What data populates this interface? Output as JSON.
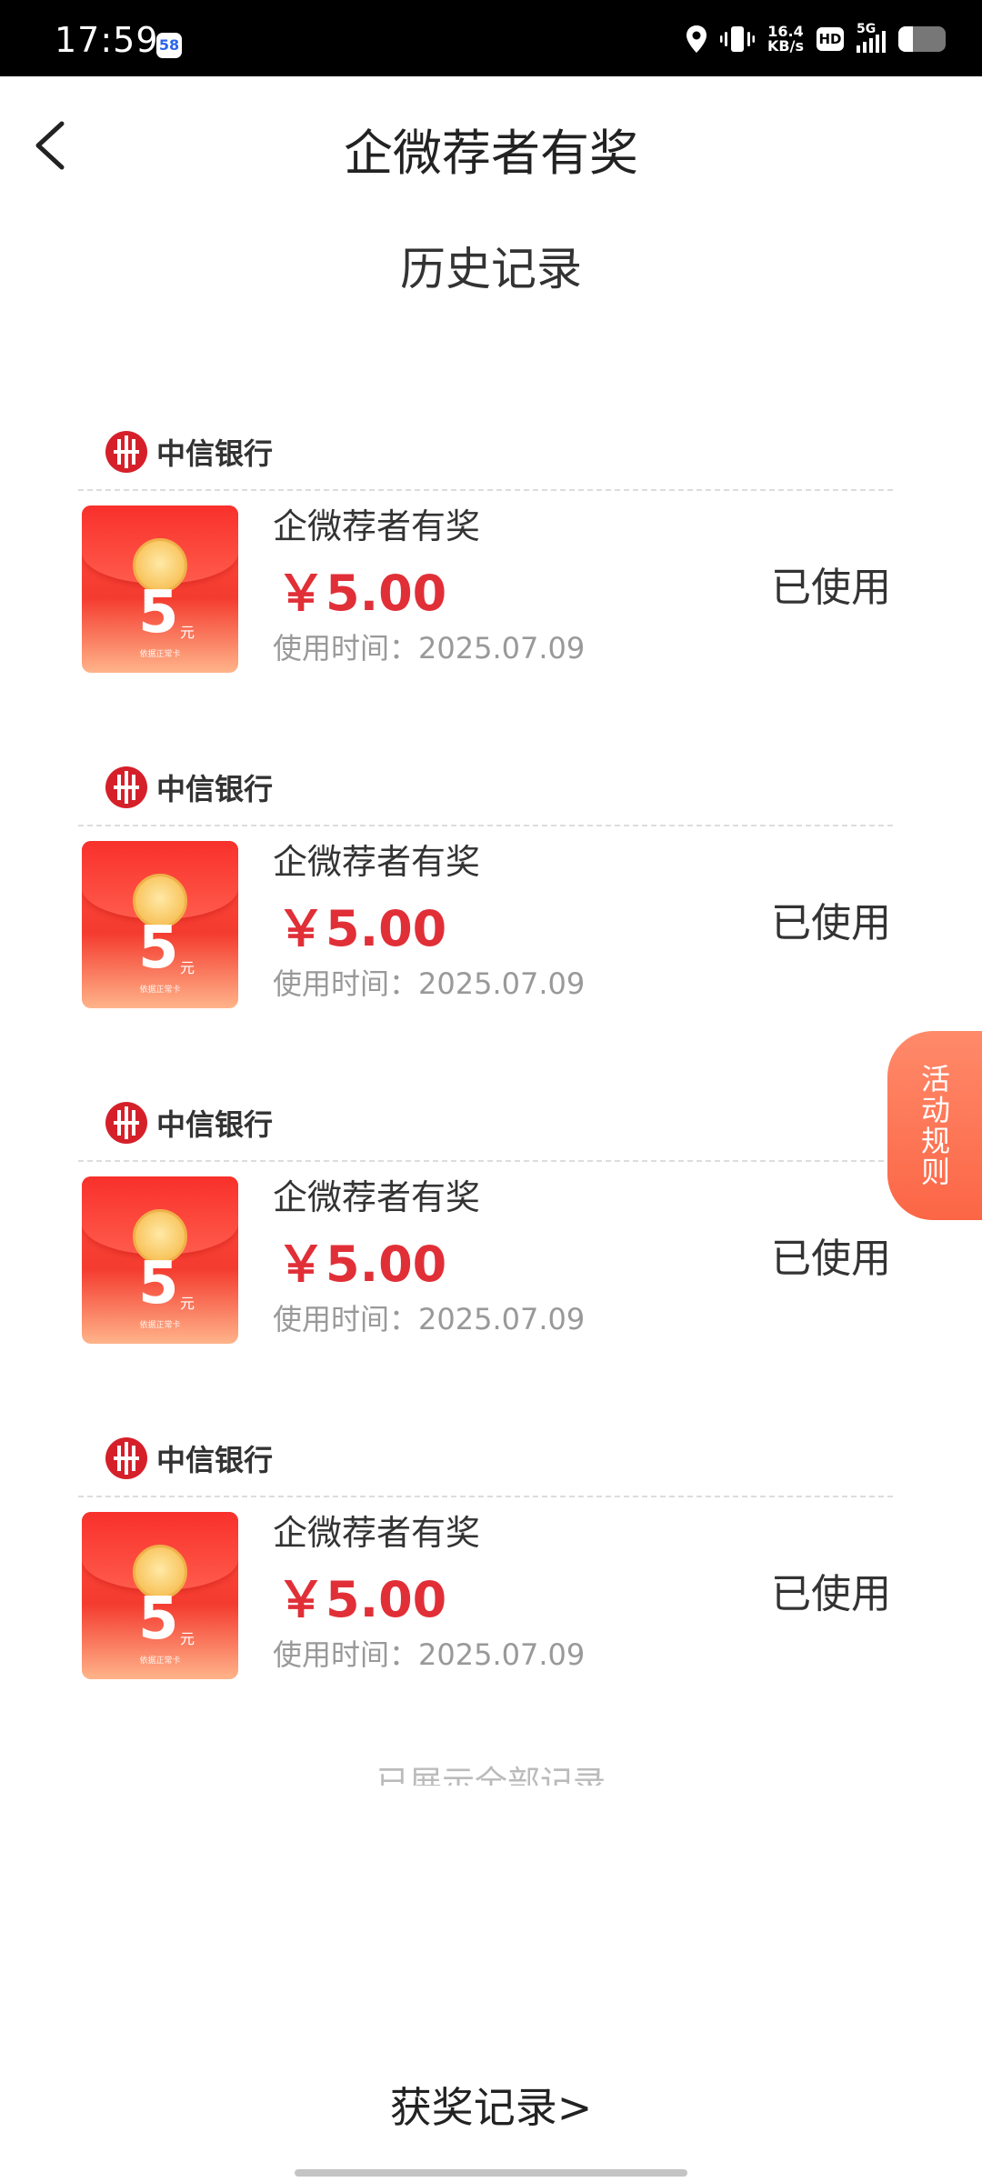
{
  "status_bar": {
    "time": "17:59",
    "app_badge": "58",
    "net_speed_value": "16.4",
    "net_speed_unit": "KB/s",
    "hd_label": "HD",
    "network_label": "5G",
    "battery_level": 0.3
  },
  "header": {
    "title": "企微荐者有奖"
  },
  "section_title": "历史记录",
  "records": [
    {
      "bank": "中信银行",
      "name": "企微荐者有奖",
      "amount": "￥5.00",
      "time": "使用时间：2025.07.09",
      "status": "已使用",
      "coupon_number": "5",
      "coupon_unit": "元",
      "coupon_footer": "依据正常卡"
    },
    {
      "bank": "中信银行",
      "name": "企微荐者有奖",
      "amount": "￥5.00",
      "time": "使用时间：2025.07.09",
      "status": "已使用",
      "coupon_number": "5",
      "coupon_unit": "元",
      "coupon_footer": "依据正常卡"
    },
    {
      "bank": "中信银行",
      "name": "企微荐者有奖",
      "amount": "￥5.00",
      "time": "使用时间：2025.07.09",
      "status": "已使用",
      "coupon_number": "5",
      "coupon_unit": "元",
      "coupon_footer": "依据正常卡"
    },
    {
      "bank": "中信银行",
      "name": "企微荐者有奖",
      "amount": "￥5.00",
      "time": "使用时间：2025.07.09",
      "status": "已使用",
      "coupon_number": "5",
      "coupon_unit": "元",
      "coupon_footer": "依据正常卡"
    }
  ],
  "rules_button": {
    "chars": [
      "活",
      "动",
      "规",
      "则"
    ]
  },
  "end_text": "已展示全部记录",
  "award_link": "获奖记录>",
  "colors": {
    "amount": "#e12f37",
    "rules_button": "#fb6646",
    "bank_logo": "#d5202a"
  }
}
